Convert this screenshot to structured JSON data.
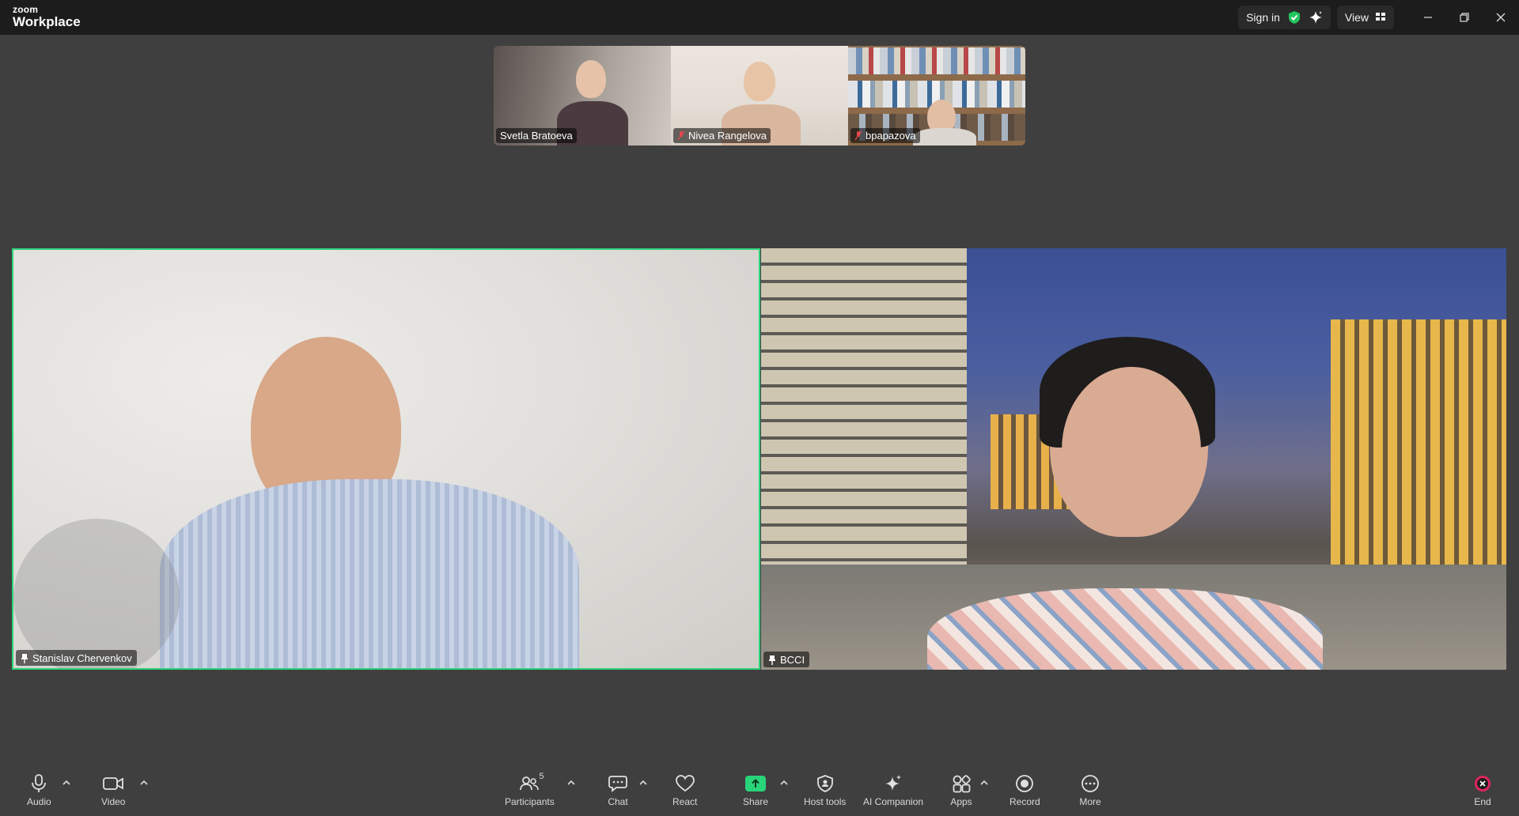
{
  "app": {
    "brand_small": "zoom",
    "brand_big": "Workplace"
  },
  "topbar": {
    "sign_in_label": "Sign in",
    "view_label": "View"
  },
  "gallery": [
    {
      "name": "Svetla Bratoeva",
      "muted": false
    },
    {
      "name": "Nivea Rangelova",
      "muted": true
    },
    {
      "name": "bpapazova",
      "muted": true
    }
  ],
  "speakers": [
    {
      "name": "Stanislav Chervenkov",
      "pinned": true,
      "active": true
    },
    {
      "name": "BCCI",
      "pinned": true,
      "active": false
    }
  ],
  "toolbar": {
    "audio_label": "Audio",
    "video_label": "Video",
    "participants_label": "Participants",
    "participants_count": "5",
    "chat_label": "Chat",
    "react_label": "React",
    "share_label": "Share",
    "host_tools_label": "Host tools",
    "ai_companion_label": "AI Companion",
    "apps_label": "Apps",
    "record_label": "Record",
    "more_label": "More",
    "end_label": "End"
  },
  "colors": {
    "active_speaker_border": "#2dd37a",
    "share_green": "#27d47a",
    "end_red": "#e0245e",
    "background": "#3f3f3f",
    "titlebar": "#1c1c1c"
  }
}
